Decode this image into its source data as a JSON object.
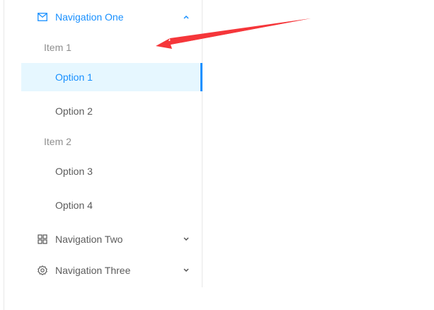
{
  "menu": {
    "nav_one": {
      "label": "Navigation One",
      "icon": "mail-icon",
      "expanded": true
    },
    "group_one": {
      "label": "Item 1"
    },
    "group_two": {
      "label": "Item 2"
    },
    "options": [
      {
        "label": "Option 1",
        "selected": true
      },
      {
        "label": "Option 2",
        "selected": false
      },
      {
        "label": "Option 3",
        "selected": false
      },
      {
        "label": "Option 4",
        "selected": false
      }
    ],
    "nav_two": {
      "label": "Navigation Two",
      "icon": "appstore-icon",
      "expanded": false
    },
    "nav_three": {
      "label": "Navigation Three",
      "icon": "settings-icon",
      "expanded": false
    }
  },
  "colors": {
    "accent": "#1890ff",
    "selected_bg": "#e6f7ff",
    "annotation_arrow": "#f5363a"
  }
}
